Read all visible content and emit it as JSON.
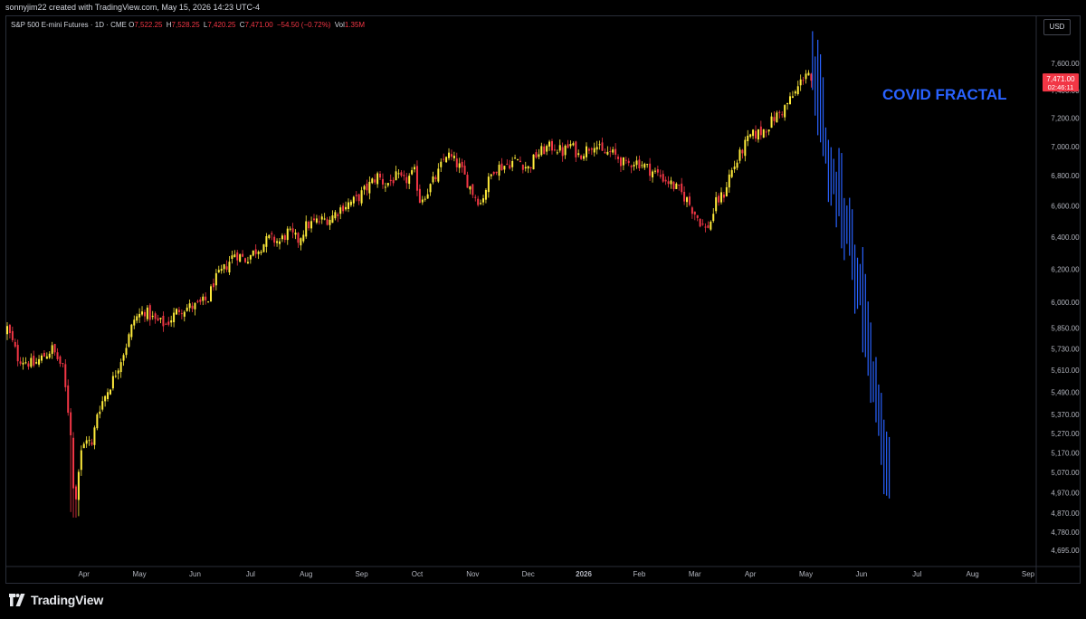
{
  "header": {
    "caption": "sonnyjim22 created with TradingView.com, May 15, 2026 14:23 UTC-4"
  },
  "legend": {
    "symbol": "S&P 500 E-mini Futures · 1D · CME",
    "open_label": "O",
    "open": "7,522.25",
    "high_label": "H",
    "high": "7,528.25",
    "low_label": "L",
    "low": "7,420.25",
    "close_label": "C",
    "close": "7,471.00",
    "change": "−54.50 (−0.72%)",
    "vol_label": "Vol",
    "vol": "1.35M"
  },
  "currency": "USD",
  "price_badge": {
    "price": "7,471.00",
    "countdown": "02:46:11",
    "color": "#f23645"
  },
  "annotation": {
    "text": "COVID FRACTAL",
    "color": "#2962ff"
  },
  "brand": {
    "name": "TradingView"
  },
  "chart_data": {
    "type": "candlestick",
    "yscale": "log",
    "ylim": [
      4650,
      7700
    ],
    "y_ticks": [
      "7,600.00",
      "7,400.00",
      "7,200.00",
      "7,000.00",
      "6,800.00",
      "6,600.00",
      "6,400.00",
      "6,200.00",
      "6,000.00",
      "5,850.00",
      "5,730.00",
      "5,610.00",
      "5,490.00",
      "5,370.00",
      "5,270.00",
      "5,170.00",
      "5,070.00",
      "4,970.00",
      "4,870.00",
      "4,780.00",
      "4,695.00"
    ],
    "y_tick_values": [
      7600,
      7400,
      7200,
      7000,
      6800,
      6600,
      6400,
      6200,
      6000,
      5850,
      5730,
      5610,
      5490,
      5370,
      5270,
      5170,
      5070,
      4970,
      4870,
      4780,
      4695
    ],
    "x_ticks": [
      "Apr",
      "May",
      "Jun",
      "Jul",
      "Aug",
      "Sep",
      "Oct",
      "Nov",
      "Dec",
      "2026",
      "Feb",
      "Mar",
      "Apr",
      "May",
      "Jun",
      "Jul",
      "Aug",
      "Sep"
    ],
    "x_tick_index": [
      29,
      50,
      71,
      92,
      113,
      134,
      155,
      176,
      197,
      218,
      239,
      260,
      281,
      302,
      323,
      344,
      365,
      386
    ],
    "colors": {
      "up": "#ffeb3b",
      "down": "#f23645",
      "fractal": "#2962ff"
    },
    "main_close_path": [
      [
        0,
        5850
      ],
      [
        4,
        5680
      ],
      [
        10,
        5640
      ],
      [
        17,
        5730
      ],
      [
        21,
        5620
      ],
      [
        24,
        5280
      ],
      [
        25,
        4980
      ],
      [
        26,
        4940
      ],
      [
        28,
        5170
      ],
      [
        30,
        5250
      ],
      [
        32,
        5200
      ],
      [
        34,
        5380
      ],
      [
        40,
        5560
      ],
      [
        45,
        5750
      ],
      [
        48,
        5900
      ],
      [
        52,
        5950
      ],
      [
        56,
        5890
      ],
      [
        60,
        5870
      ],
      [
        65,
        5960
      ],
      [
        72,
        5980
      ],
      [
        76,
        6020
      ],
      [
        78,
        6120
      ],
      [
        82,
        6200
      ],
      [
        86,
        6300
      ],
      [
        90,
        6260
      ],
      [
        95,
        6330
      ],
      [
        99,
        6390
      ],
      [
        103,
        6370
      ],
      [
        106,
        6430
      ],
      [
        110,
        6380
      ],
      [
        113,
        6470
      ],
      [
        117,
        6500
      ],
      [
        122,
        6520
      ],
      [
        127,
        6600
      ],
      [
        132,
        6640
      ],
      [
        136,
        6720
      ],
      [
        140,
        6800
      ],
      [
        143,
        6740
      ],
      [
        147,
        6790
      ],
      [
        150,
        6760
      ],
      [
        154,
        6820
      ],
      [
        156,
        6640
      ],
      [
        159,
        6700
      ],
      [
        163,
        6820
      ],
      [
        166,
        6950
      ],
      [
        169,
        6900
      ],
      [
        171,
        6860
      ],
      [
        174,
        6760
      ],
      [
        176,
        6690
      ],
      [
        179,
        6620
      ],
      [
        181,
        6720
      ],
      [
        184,
        6850
      ],
      [
        188,
        6870
      ],
      [
        193,
        6910
      ],
      [
        197,
        6850
      ],
      [
        200,
        6940
      ],
      [
        204,
        6990
      ],
      [
        207,
        7000
      ],
      [
        210,
        6960
      ],
      [
        213,
        7010
      ],
      [
        216,
        6940
      ],
      [
        219,
        6980
      ],
      [
        222,
        7030
      ],
      [
        225,
        6950
      ],
      [
        228,
        6960
      ],
      [
        231,
        6920
      ],
      [
        234,
        6870
      ],
      [
        237,
        6900
      ],
      [
        240,
        6880
      ],
      [
        243,
        6840
      ],
      [
        246,
        6810
      ],
      [
        250,
        6760
      ],
      [
        254,
        6700
      ],
      [
        257,
        6640
      ],
      [
        259,
        6580
      ],
      [
        262,
        6500
      ],
      [
        264,
        6450
      ],
      [
        266,
        6500
      ],
      [
        268,
        6620
      ],
      [
        271,
        6680
      ],
      [
        273,
        6800
      ],
      [
        276,
        6900
      ],
      [
        278,
        6980
      ],
      [
        281,
        7070
      ],
      [
        285,
        7100
      ],
      [
        288,
        7150
      ],
      [
        290,
        7200
      ],
      [
        293,
        7250
      ],
      [
        296,
        7330
      ],
      [
        298,
        7380
      ],
      [
        300,
        7460
      ],
      [
        302,
        7540
      ],
      [
        303,
        7530
      ],
      [
        304,
        7471
      ]
    ],
    "fractal_path": [
      [
        304,
        7520
      ],
      [
        306,
        7350
      ],
      [
        308,
        7050
      ],
      [
        311,
        6800
      ],
      [
        314,
        6650
      ],
      [
        316,
        6500
      ],
      [
        318,
        6350
      ],
      [
        320,
        6200
      ],
      [
        322,
        6050
      ],
      [
        324,
        5850
      ],
      [
        326,
        5600
      ],
      [
        328,
        5450
      ],
      [
        330,
        5250
      ],
      [
        331,
        5100
      ],
      [
        332,
        5030
      ],
      [
        333,
        5000
      ],
      [
        334,
        4930
      ]
    ],
    "last_candle": {
      "open": 7522.25,
      "high": 7528.25,
      "low": 7420.25,
      "close": 7471.0
    }
  }
}
